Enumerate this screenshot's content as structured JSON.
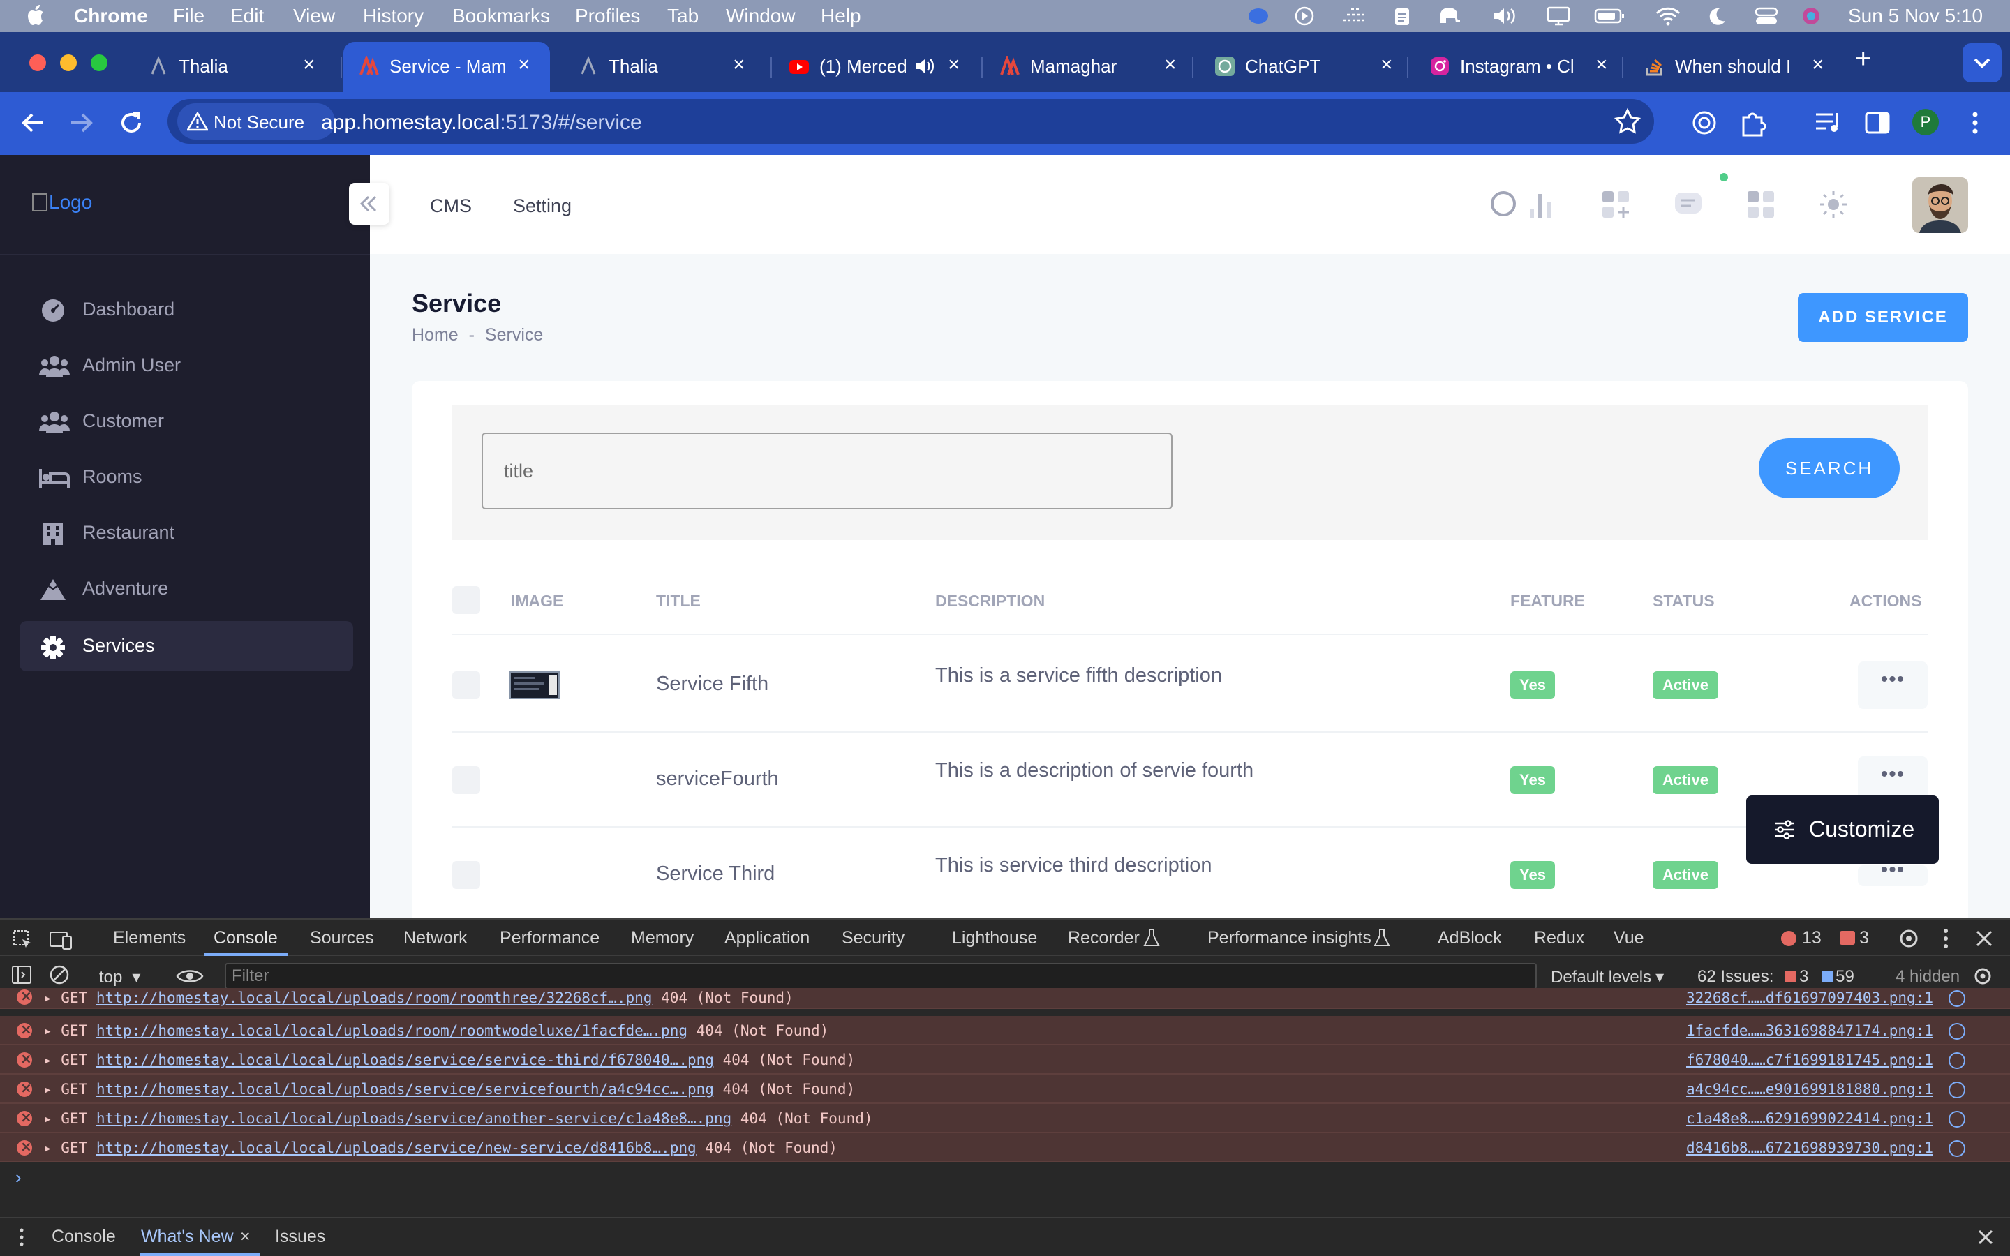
{
  "menubar": {
    "app": "Chrome",
    "items": [
      "File",
      "Edit",
      "View",
      "History",
      "Bookmarks",
      "Profiles",
      "Tab",
      "Window",
      "Help"
    ],
    "clock": "Sun 5 Nov  5:10"
  },
  "tabs": [
    {
      "label": "Thalia",
      "icon": "thalia-icon"
    },
    {
      "label": "Service - Mam",
      "icon": "mamaghar-icon",
      "active": true
    },
    {
      "label": "Thalia",
      "icon": "thalia-icon"
    },
    {
      "label": "(1) Merced",
      "icon": "youtube-icon"
    },
    {
      "label": "Mamaghar",
      "icon": "mamaghar-icon"
    },
    {
      "label": "ChatGPT",
      "icon": "chatgpt-icon"
    },
    {
      "label": "Instagram • Cl",
      "icon": "instagram-icon"
    },
    {
      "label": "When should I",
      "icon": "stackoverflow-icon"
    }
  ],
  "toolbar": {
    "security_label": "Not Secure",
    "url_host": "app.homestay.local",
    "url_path": ":5173/#/service",
    "profile_initial": "P"
  },
  "sidebar": {
    "logo_alt": "Logo",
    "items": [
      {
        "label": "Dashboard",
        "icon": "dashboard-icon"
      },
      {
        "label": "Admin User",
        "icon": "users-icon"
      },
      {
        "label": "Customer",
        "icon": "users-icon"
      },
      {
        "label": "Rooms",
        "icon": "bed-icon"
      },
      {
        "label": "Restaurant",
        "icon": "building-icon"
      },
      {
        "label": "Adventure",
        "icon": "mountain-icon"
      },
      {
        "label": "Services",
        "icon": "gear-icon",
        "active": true
      }
    ]
  },
  "header": {
    "nav": [
      "CMS",
      "Setting"
    ]
  },
  "page": {
    "title": "Service",
    "breadcrumb": [
      "Home",
      "-",
      "Service"
    ],
    "add_button": "ADD SERVICE",
    "search_placeholder": "title",
    "search_button": "SEARCH",
    "customize_button": "Customize"
  },
  "table": {
    "columns": [
      "IMAGE",
      "TITLE",
      "DESCRIPTION",
      "FEATURE",
      "STATUS",
      "ACTIONS"
    ],
    "rows": [
      {
        "title": "Service Fifth",
        "description": "This is a service fifth description",
        "feature": "Yes",
        "status": "Active",
        "has_image": true
      },
      {
        "title": "serviceFourth",
        "description": "This is a description of servie fourth",
        "feature": "Yes",
        "status": "Active",
        "has_image": false
      },
      {
        "title": "Service Third",
        "description": "This is service third description",
        "feature": "Yes",
        "status": "Active",
        "has_image": false
      }
    ],
    "action_label": "•••"
  },
  "devtools": {
    "tabs": [
      "Elements",
      "Console",
      "Sources",
      "Network",
      "Performance",
      "Memory",
      "Application",
      "Security",
      "Lighthouse",
      "Recorder",
      "Performance insights",
      "AdBlock",
      "Redux",
      "Vue"
    ],
    "active_tab": "Console",
    "error_count": "13",
    "warning_count": "3",
    "context": "top",
    "filter_placeholder": "Filter",
    "levels": "Default levels",
    "issues_label": "62 Issues:",
    "issues_errors": "3",
    "issues_info": "59",
    "hidden": "4 hidden",
    "logs": [
      {
        "method": "GET",
        "url": "http://homestay.local/local/uploads/room/roomthree/32268cf….png",
        "status": "404 (Not Found)",
        "source": "32268cf……df61697097403.png:1"
      },
      {
        "method": "GET",
        "url": "http://homestay.local/local/uploads/room/roomtwodeluxe/1facfde….png",
        "status": "404 (Not Found)",
        "source": "1facfde……3631698847174.png:1"
      },
      {
        "method": "GET",
        "url": "http://homestay.local/local/uploads/service/service-third/f678040….png",
        "status": "404 (Not Found)",
        "source": "f678040……c7f1699181745.png:1"
      },
      {
        "method": "GET",
        "url": "http://homestay.local/local/uploads/service/servicefourth/a4c94cc….png",
        "status": "404 (Not Found)",
        "source": "a4c94cc……e901699181880.png:1"
      },
      {
        "method": "GET",
        "url": "http://homestay.local/local/uploads/service/another-service/c1a48e8….png",
        "status": "404 (Not Found)",
        "source": "c1a48e8……6291699022414.png:1"
      },
      {
        "method": "GET",
        "url": "http://homestay.local/local/uploads/service/new-service/d8416b8….png",
        "status": "404 (Not Found)",
        "source": "d8416b8……6721698939730.png:1"
      }
    ],
    "drawer_tabs": [
      "Console",
      "What's New",
      "Issues"
    ],
    "drawer_active": "What's New"
  },
  "colors": {
    "accent": "#3e97ff",
    "sidebar_bg": "#1e1e2d",
    "badge_green": "#6fd38e",
    "chrome_tab_bg": "#1f3a82",
    "chrome_toolbar": "#2e5bd3"
  }
}
